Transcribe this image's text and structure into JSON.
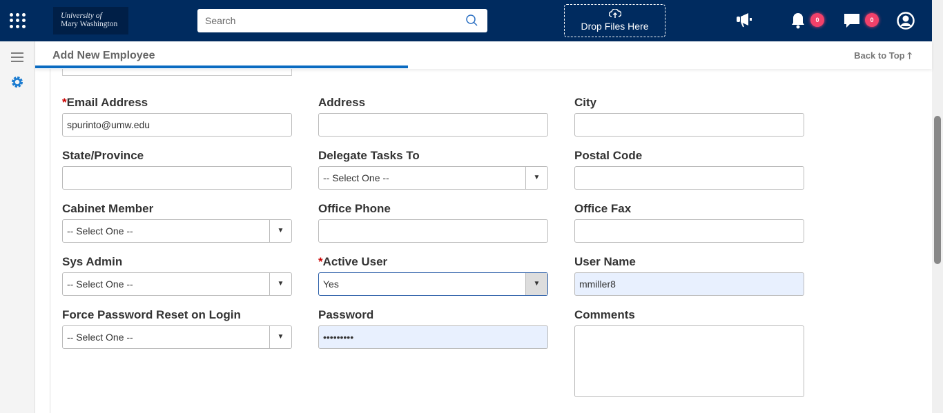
{
  "topbar": {
    "logo_line1": "University of",
    "logo_line2": "Mary Washington",
    "search_placeholder": "Search",
    "drop_label": "Drop Files Here",
    "notifications_count": "0",
    "messages_count": "0"
  },
  "header": {
    "title": "Add New Employee",
    "back_to_top": "Back to Top"
  },
  "form": {
    "email": {
      "label": "Email Address",
      "value": "spurinto@umw.edu"
    },
    "address": {
      "label": "Address",
      "value": ""
    },
    "city": {
      "label": "City",
      "value": ""
    },
    "state": {
      "label": "State/Province",
      "value": ""
    },
    "delegate": {
      "label": "Delegate Tasks To",
      "value": "-- Select One --"
    },
    "postal": {
      "label": "Postal Code",
      "value": ""
    },
    "cabinet": {
      "label": "Cabinet Member",
      "value": "-- Select One --"
    },
    "phone": {
      "label": "Office Phone",
      "value": ""
    },
    "fax": {
      "label": "Office Fax",
      "value": ""
    },
    "sysadmin": {
      "label": "Sys Admin",
      "value": "-- Select One --"
    },
    "active": {
      "label": "Active User",
      "value": "Yes"
    },
    "username": {
      "label": "User Name",
      "value": "mmiller8"
    },
    "forcereset": {
      "label": "Force Password Reset on Login",
      "value": "-- Select One --"
    },
    "password": {
      "label": "Password",
      "value": "•••••••••"
    },
    "comments": {
      "label": "Comments",
      "value": ""
    }
  }
}
